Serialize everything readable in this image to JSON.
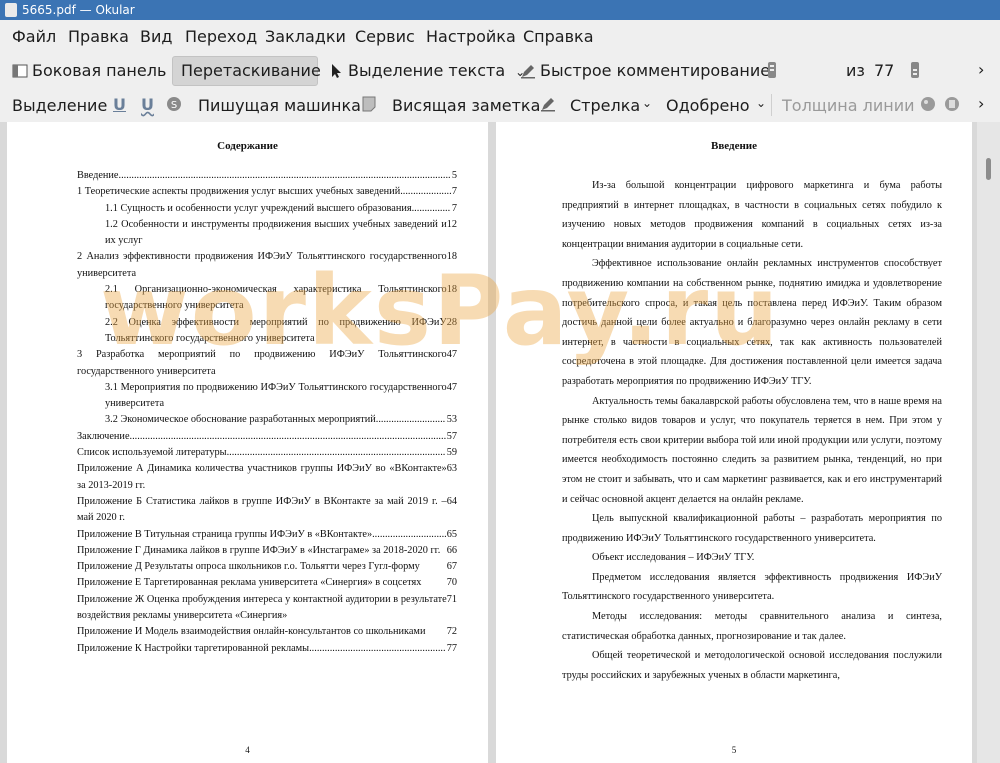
{
  "window": {
    "title": "5665.pdf  — Okular"
  },
  "menu": [
    "Файл",
    "Правка",
    "Вид",
    "Переход",
    "Закладки",
    "Сервис",
    "Настройка",
    "Справка"
  ],
  "toolbar1": {
    "sidebar": "Боковая панель",
    "drag": "Перетаскивание",
    "text_select": "Выделение текста",
    "quick_comment": "Быстрое комментирование",
    "page_current": "4",
    "page_of": "из",
    "page_total": "77"
  },
  "toolbar2": {
    "select": "Выделение",
    "typewriter": "Пишущая машинка",
    "sticky": "Висящая заметка",
    "arrow": "Стрелка",
    "approved": "Одобрено",
    "line_width": "Толщина линии"
  },
  "page_left": {
    "title": "Содержание",
    "toc": [
      {
        "t": "Введение",
        "n": "5",
        "lvl": 0
      },
      {
        "t": "1 Теоретические аспекты продвижения услуг высших учебных заведений",
        "n": "7",
        "lvl": 0
      },
      {
        "t": "1.1 Сущность и особенности услуг учреждений высшего образования",
        "n": "7",
        "lvl": 1
      },
      {
        "t": "1.2 Особенности и инструменты продвижения высших учебных заведений и их услуг",
        "n": "12",
        "lvl": 1,
        "multi": true
      },
      {
        "t": "2 Анализ эффективности продвижения ИФЭиУ Тольяттинского государственного университета",
        "n": "18",
        "lvl": 0,
        "multi": true
      },
      {
        "t": "2.1 Организационно-экономическая характеристика Тольяттинского государственного университета",
        "n": "18",
        "lvl": 1,
        "multi": true
      },
      {
        "t": "2.2 Оценка эффективности мероприятий по продвижению ИФЭиУ Тольяттинского государственного университета",
        "n": "28",
        "lvl": 1,
        "multi": true
      },
      {
        "t": "3 Разработка мероприятий по продвижению ИФЭиУ Тольяттинского государственного университета",
        "n": "47",
        "lvl": 0,
        "multi": true
      },
      {
        "t": "3.1 Мероприятия по продвижению ИФЭиУ Тольяттинского государственного университета",
        "n": "47",
        "lvl": 1,
        "multi": true
      },
      {
        "t": "3.2 Экономическое обоснование разработанных мероприятий",
        "n": "53",
        "lvl": 1
      },
      {
        "t": "Заключение",
        "n": "57",
        "lvl": 0
      },
      {
        "t": "Список используемой литературы",
        "n": "59",
        "lvl": 0
      },
      {
        "t": "Приложение А Динамика количества участников группы ИФЭиУ во «ВКонтакте» за 2013-2019 гг.",
        "n": "63",
        "lvl": 0,
        "multi": true
      },
      {
        "t": "Приложение Б Статистика лайков в группе ИФЭиУ в ВКонтакте за май 2019 г. – май 2020 г.",
        "n": "64",
        "lvl": 0,
        "multi": true
      },
      {
        "t": "Приложение В Титульная страница группы ИФЭиУ в «ВКонтакте»",
        "n": "65",
        "lvl": 0
      },
      {
        "t": "Приложение Г Динамика лайков в группе ИФЭиУ в «Инстаграме» за 2018-2020 гг.",
        "n": "66",
        "lvl": 0,
        "multi": true
      },
      {
        "t": "Приложение Д Результаты опроса школьников г.о. Тольятти через Гугл-форму",
        "n": "67",
        "lvl": 0,
        "multi": true
      },
      {
        "t": "Приложение Е Таргетированная реклама университета «Синергия» в соцсетях",
        "n": "70",
        "lvl": 0,
        "multi": true
      },
      {
        "t": "Приложение Ж Оценка пробуждения интереса у контактной аудитории в результате воздействия рекламы университета «Синергия»",
        "n": "71",
        "lvl": 0,
        "multi": true
      },
      {
        "t": "Приложение И Модель взаимодействия онлайн-консультантов со школьниками",
        "n": "72",
        "lvl": 0,
        "multi": true
      },
      {
        "t": "Приложение К Настройки таргетированной рекламы",
        "n": "77",
        "lvl": 0
      }
    ],
    "page_number": "4"
  },
  "page_right": {
    "title": "Введение",
    "paragraphs": [
      "Из-за большой концентрации цифрового маркетинга и бума работы предприятий в интернет площадках, в частности в социальных сетях побудило к изучению новых методов продвижения компаний в социальных сетях из-за концентрации внимания аудитории в социальные сети.",
      "Эффективное использование онлайн рекламных инструментов способствует продвижению компании на собственном рынке, поднятию имиджа и удовлетворение потребительского спроса, и такая цель поставлена перед ИФЭиУ. Таким образом достичь данной цели более актуально и благоразумно через онлайн рекламу в сети интернет, в частности в социальных сетях, так как активность пользователей сосредоточена в этой площадке. Для достижения поставленной цели имеется задача разработать мероприятия по продвижению ИФЭиУ ТГУ.",
      "Актуальность темы бакалаврской работы обусловлена тем, что в наше время на рынке столько видов товаров и услуг, что покупатель теряется в нем. При этом у потребителя есть свои критерии выбора той или иной продукции или услуги, поэтому имеется необходимость постоянно следить за развитием рынка, тенденций, но при этом не стоит и забывать, что и сам маркетинг развивается, как и его инструментарий и сейчас основной акцент делается на онлайн рекламе.",
      "Цель выпускной квалификационной работы – разработать мероприятия по продвижению ИФЭиУ Тольяттинского государственного университета.",
      "Объект исследования – ИФЭиУ ТГУ.",
      "Предметом исследования является эффективность продвижения ИФЭиУ Тольяттинского государственного университета.",
      "Методы исследования: методы сравнительного анализа и синтеза, статистическая обработка данных, прогнозирование и так далее.",
      "Общей теоретической и методологической основой исследования послужили труды российских и зарубежных ученых в области маркетинга,"
    ],
    "page_number": "5"
  },
  "watermark": "worksPay.ru"
}
